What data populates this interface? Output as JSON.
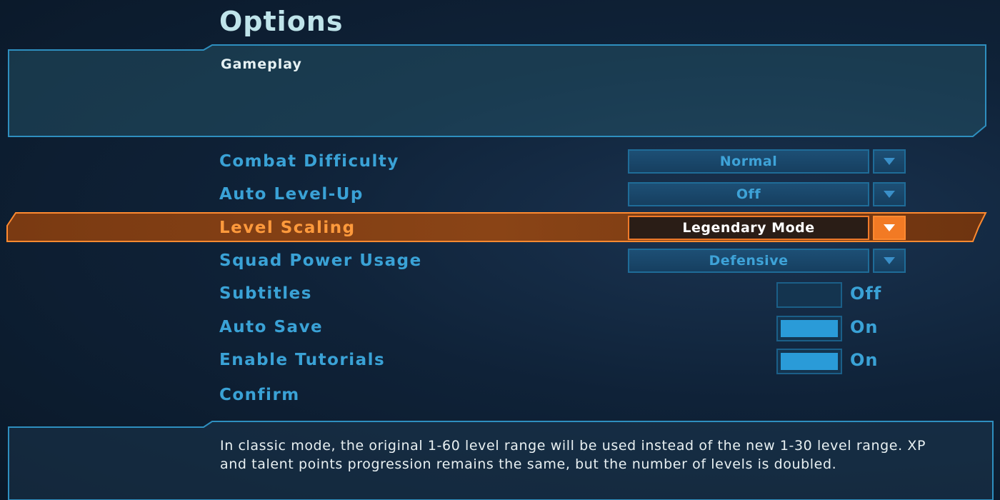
{
  "header": {
    "title": "Options"
  },
  "tab": {
    "label": "Gameplay"
  },
  "options": {
    "combat_difficulty": {
      "label": "Combat Difficulty",
      "value": "Normal"
    },
    "auto_level_up": {
      "label": "Auto Level-Up",
      "value": "Off"
    },
    "level_scaling": {
      "label": "Level Scaling",
      "value": "Legendary Mode"
    },
    "squad_power_usage": {
      "label": "Squad Power Usage",
      "value": "Defensive"
    },
    "subtitles": {
      "label": "Subtitles",
      "value": "Off",
      "enabled": false
    },
    "auto_save": {
      "label": "Auto Save",
      "value": "On",
      "enabled": true
    },
    "enable_tutorials": {
      "label": "Enable Tutorials",
      "value": "On",
      "enabled": true
    }
  },
  "confirm": {
    "label": "Confirm"
  },
  "description": {
    "text": "In classic mode, the original 1-60 level range will be used instead of the new 1-30 level range. XP and talent points progression remains the same, but the number of levels is doubled."
  },
  "colors": {
    "accent": "#3aa2d6",
    "highlight": "#ff9a3c",
    "panel_border": "#2e8fbf",
    "background": "#0f2238"
  },
  "icons": {
    "dropdown": "chevron-down-icon"
  }
}
